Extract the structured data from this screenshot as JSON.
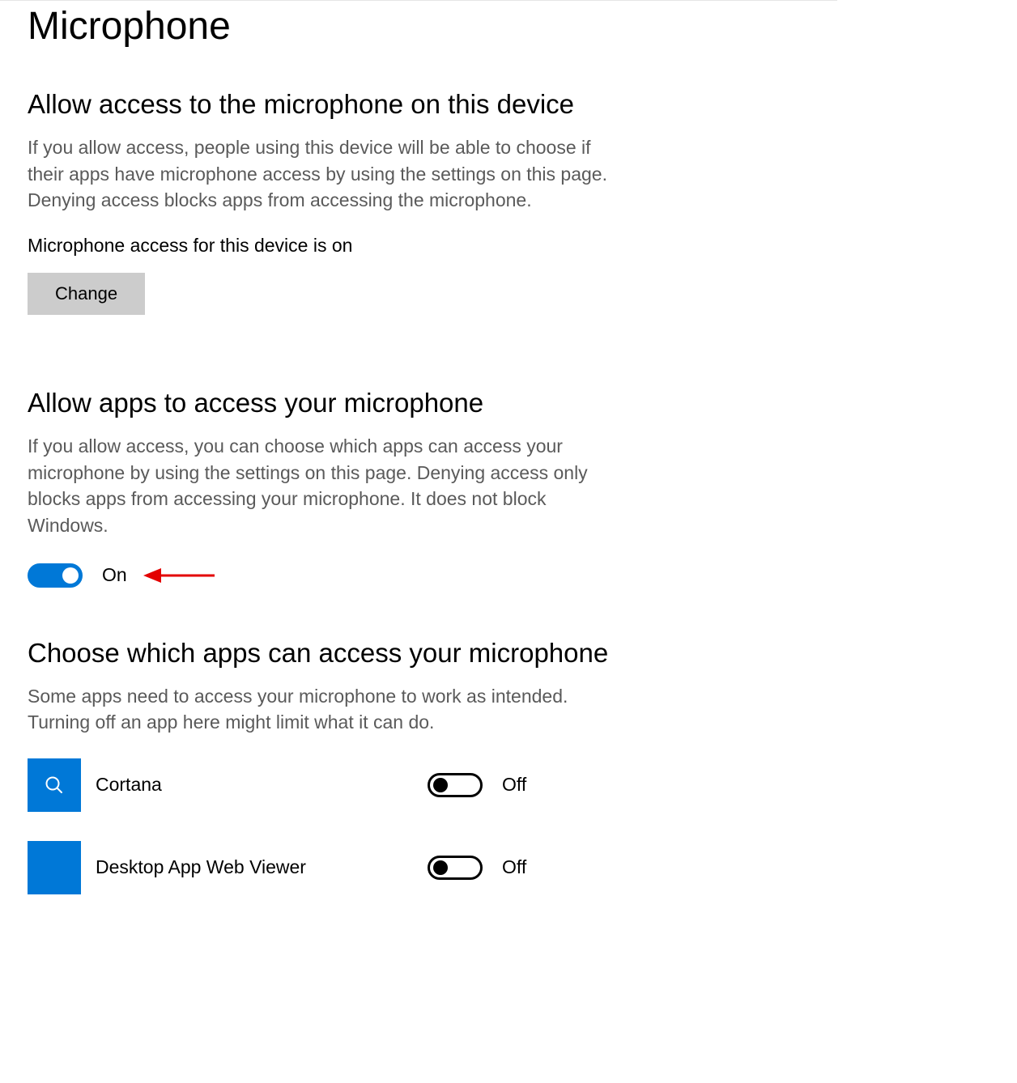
{
  "page": {
    "title": "Microphone"
  },
  "section_device": {
    "heading": "Allow access to the microphone on this device",
    "description": "If you allow access, people using this device will be able to choose if their apps have microphone access by using the settings on this page. Denying access blocks apps from accessing the microphone.",
    "status": "Microphone access for this device is on",
    "change_label": "Change"
  },
  "section_apps": {
    "heading": "Allow apps to access your microphone",
    "description": "If you allow access, you can choose which apps can access your microphone by using the settings on this page. Denying access only blocks apps from accessing your microphone. It does not block Windows.",
    "toggle_state": "On"
  },
  "section_choose": {
    "heading": "Choose which apps can access your microphone",
    "description": "Some apps need to access your microphone to work as intended. Turning off an app here might limit what it can do."
  },
  "apps": [
    {
      "name": "Cortana",
      "state": "Off",
      "icon": "search"
    },
    {
      "name": "Desktop App Web Viewer",
      "state": "Off",
      "icon": "blank"
    }
  ],
  "colors": {
    "accent": "#0078d7",
    "annotation": "#e30000"
  }
}
